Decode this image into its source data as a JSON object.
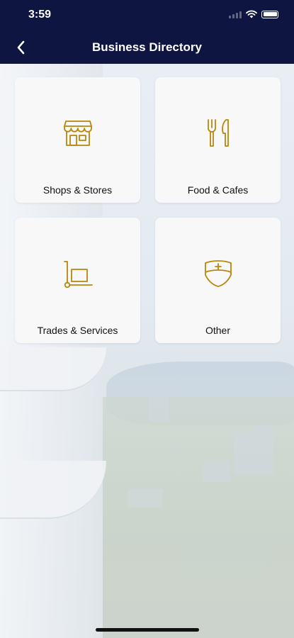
{
  "status_bar": {
    "time": "3:59"
  },
  "nav": {
    "title": "Business Directory",
    "back_icon": "chevron-left-icon"
  },
  "categories": [
    {
      "label": "Shops & Stores",
      "icon": "storefront-icon"
    },
    {
      "label": "Food & Cafes",
      "icon": "fork-knife-icon"
    },
    {
      "label": "Trades & Services",
      "icon": "hand-truck-icon"
    },
    {
      "label": "Other",
      "icon": "nurse-cap-icon"
    }
  ],
  "colors": {
    "nav_bg": "#0d1540",
    "icon_gold": "#b8860b",
    "tile_bg": "#f8f8f8"
  }
}
